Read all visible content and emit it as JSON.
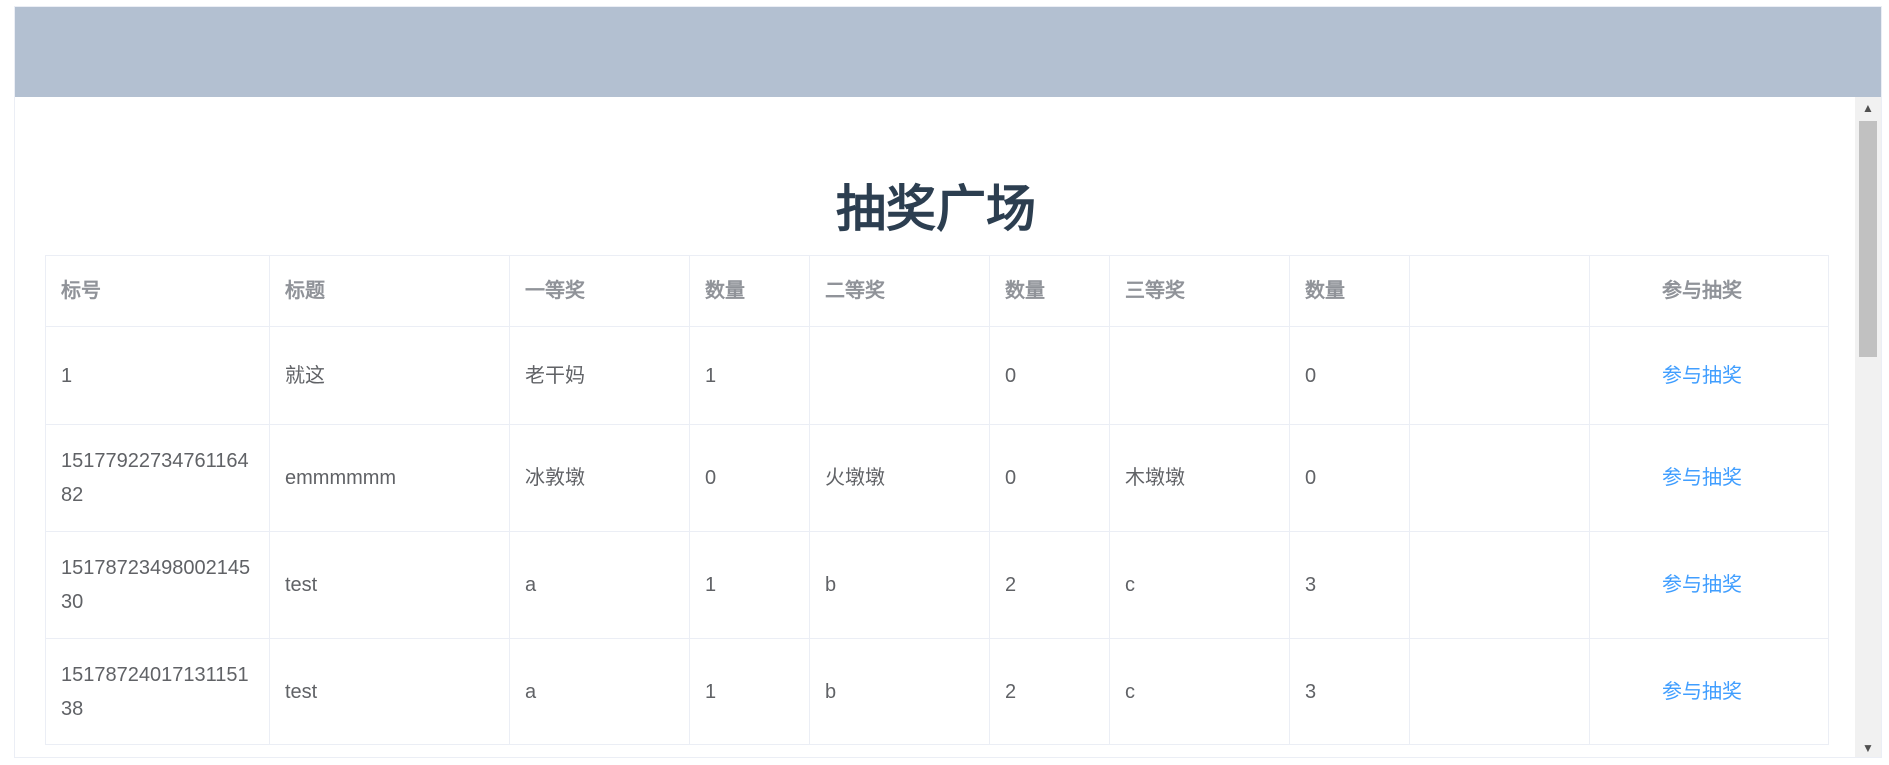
{
  "page": {
    "title": "抽奖广场"
  },
  "table": {
    "headers": {
      "id": "标号",
      "title": "标题",
      "first_prize": "一等奖",
      "first_count": "数量",
      "second_prize": "二等奖",
      "second_count": "数量",
      "third_prize": "三等奖",
      "third_count": "数量",
      "extra": "",
      "action": "参与抽奖"
    },
    "rows": [
      {
        "id": "1",
        "title": "就这",
        "first_prize": "老干妈",
        "first_count": "1",
        "second_prize": "",
        "second_count": "0",
        "third_prize": "",
        "third_count": "0",
        "action": "参与抽奖"
      },
      {
        "id": "1517792273476116482",
        "title": "emmmmmm",
        "first_prize": "冰敦墩",
        "first_count": "0",
        "second_prize": "火墩墩",
        "second_count": "0",
        "third_prize": "木墩墩",
        "third_count": "0",
        "action": "参与抽奖"
      },
      {
        "id": "1517872349800214530",
        "title": "test",
        "first_prize": "a",
        "first_count": "1",
        "second_prize": "b",
        "second_count": "2",
        "third_prize": "c",
        "third_count": "3",
        "action": "参与抽奖"
      },
      {
        "id": "1517872401713115138",
        "title": "test",
        "first_prize": "a",
        "first_count": "1",
        "second_prize": "b",
        "second_count": "2",
        "third_prize": "c",
        "third_count": "3",
        "action": "参与抽奖"
      }
    ]
  },
  "colors": {
    "banner": "#b3c0d1",
    "title": "#2c3e50",
    "link": "#409eff",
    "border": "#ebeef5",
    "header_text": "#909399",
    "cell_text": "#606266"
  },
  "icons": {
    "scroll_up": "scroll-up-arrow-icon",
    "scroll_down": "scroll-down-arrow-icon"
  }
}
